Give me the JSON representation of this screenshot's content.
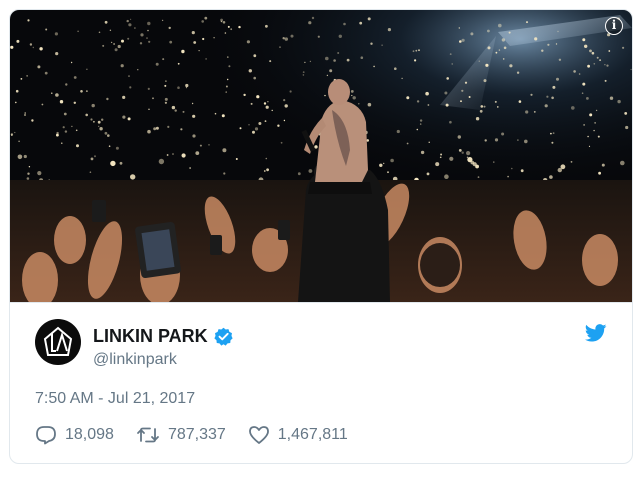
{
  "tweet": {
    "author_name": "LINKIN PARK",
    "handle": "@linkinpark",
    "timestamp": "7:50 AM - Jul 21, 2017",
    "verified": true
  },
  "stats": {
    "replies": "18,098",
    "retweets": "787,337",
    "likes": "1,467,811"
  },
  "media": {
    "info_label": "i",
    "description_icon": "concert-photo"
  },
  "colors": {
    "twitter_blue": "#1da1f2",
    "text_primary": "#14171a",
    "text_secondary": "#657786",
    "border": "#e1e8ed"
  }
}
